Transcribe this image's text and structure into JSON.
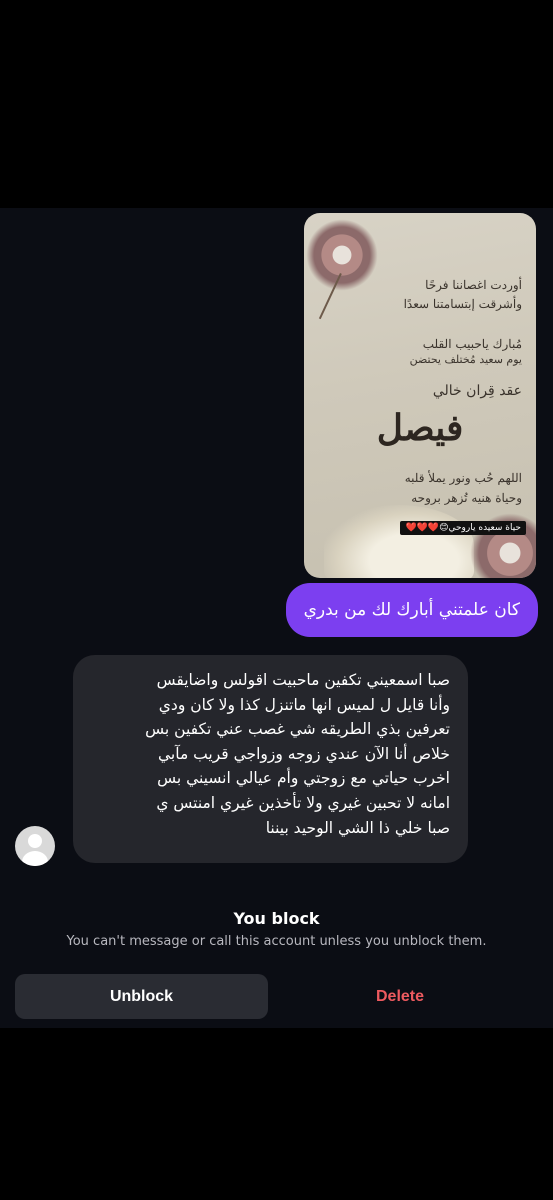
{
  "story_card": {
    "line1": "أوردت اغصاننا فرحًا",
    "line2": "وأشرقت إبتسامتنا سعدًا",
    "line3": "مُبارك ياحبيب القلب",
    "line4": "يوم سعيد مُختلف يحتضن",
    "line5": "عقد قِران خالي",
    "name": "فيصل",
    "line6": "اللهم حُب ونور يملأ قلبه",
    "line7": "وحياة هنيه تُزهر بروحه",
    "caption": "حياة سعيده ياروحي😊",
    "caption_hearts": "❤️❤️❤️"
  },
  "sent_message": "كان علمتني أبارك لك من بدري",
  "received_message": {
    "lines": [
      "صبا اسمعيني تكفين ماحبيت اقولس واضايقس",
      "وأنا قايل ل لميس انها ماتنزل كذا ولا كان ودي",
      "تعرفين بذي الطريقه شي غصب عني تكفين بس",
      "خلاص أنا الآن عندي زوجه وزواجي قريب مآبي",
      "اخرب حياتي مع زوجتي وأم عيالي انسيني بس",
      "امانه لا تحبين غيري ولا تأخذين غيري امنتس ي",
      "صبا خلي ذا الشي الوحيد بيننا"
    ]
  },
  "block_notice": {
    "title": "You block",
    "subtitle": "You can't message or call this account unless you unblock them."
  },
  "actions": {
    "unblock": "Unblock",
    "delete": "Delete"
  },
  "colors": {
    "sent_bubble": "#7c3ff0",
    "received_bubble": "#25262c",
    "delete_text": "#ee5a5f",
    "background": "#0b0d14"
  }
}
